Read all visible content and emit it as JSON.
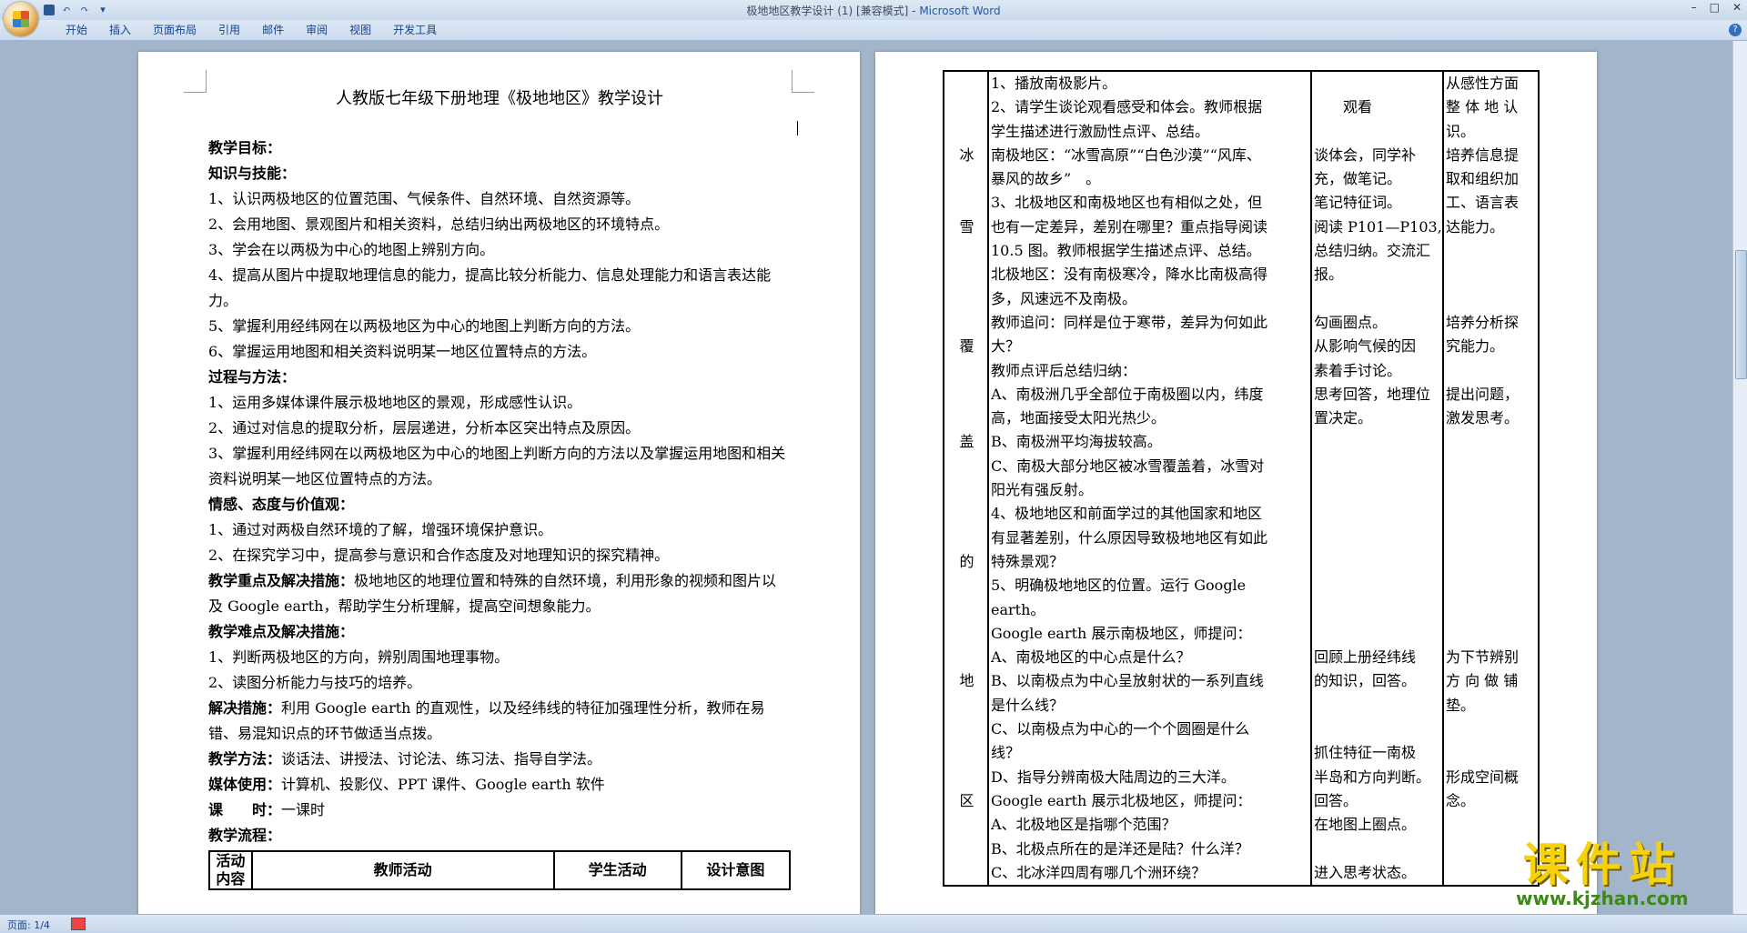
{
  "window": {
    "title": "极地地区教学设计 (1) [兼容模式] - ",
    "app_name": "Microsoft Word",
    "controls": [
      "–",
      "□",
      "✕"
    ]
  },
  "quick_access": {
    "icons": [
      "save-icon",
      "undo-icon",
      "redo-icon"
    ],
    "undo": "↶",
    "redo": "↷",
    "more": "▾"
  },
  "ribbon": {
    "tabs": [
      "开始",
      "插入",
      "页面布局",
      "引用",
      "邮件",
      "审阅",
      "视图",
      "开发工具"
    ],
    "help": "?"
  },
  "page1": {
    "title": "人教版七年级下册地理《极地地区》教学设计",
    "lines": [
      {
        "bold": "教学目标：",
        "text": ""
      },
      {
        "bold": "知识与技能：",
        "text": ""
      },
      {
        "bold": "",
        "text": "1、认识两极地区的位置范围、气候条件、自然环境、自然资源等。"
      },
      {
        "bold": "",
        "text": "2、会用地图、景观图片和相关资料，总结归纳出两极地区的环境特点。"
      },
      {
        "bold": "",
        "text": "3、学会在以两极为中心的地图上辨别方向。"
      },
      {
        "bold": "",
        "text": "4、提高从图片中提取地理信息的能力，提高比较分析能力、信息处理能力和语言表达能力。"
      },
      {
        "bold": "",
        "text": "5、掌握利用经纬网在以两极地区为中心的地图上判断方向的方法。"
      },
      {
        "bold": "",
        "text": "6、掌握运用地图和相关资料说明某一地区位置特点的方法。"
      },
      {
        "bold": "过程与方法：",
        "text": ""
      },
      {
        "bold": "",
        "text": "1、运用多媒体课件展示极地地区的景观，形成感性认识。"
      },
      {
        "bold": "",
        "text": "2、通过对信息的提取分析，层层递进，分析本区突出特点及原因。"
      },
      {
        "bold": "",
        "text": "3、掌握利用经纬网在以两极地区为中心的地图上判断方向的方法以及掌握运用地图和相关资料说明某一地区位置特点的方法。"
      },
      {
        "bold": "情感、态度与价值观：",
        "text": ""
      },
      {
        "bold": "",
        "text": "1、通过对两极自然环境的了解，增强环境保护意识。"
      },
      {
        "bold": "",
        "text": "2、在探究学习中，提高参与意识和合作态度及对地理知识的探究精神。"
      },
      {
        "bold": "教学重点及解决措施：",
        "text": "极地地区的地理位置和特殊的自然环境，利用形象的视频和图片以及 Google earth，帮助学生分析理解，提高空间想象能力。"
      },
      {
        "bold": "教学难点及解决措施：",
        "text": ""
      },
      {
        "bold": "",
        "text": "1、判断两极地区的方向，辨别周围地理事物。"
      },
      {
        "bold": "",
        "text": "2、读图分析能力与技巧的培养。"
      },
      {
        "bold": "解决措施：",
        "text": "利用 Google earth 的直观性，以及经纬线的特征加强理性分析，教师在易错、易混知识点的环节做适当点拨。"
      },
      {
        "bold": "教学方法：",
        "text": "谈话法、讲授法、讨论法、练习法、指导自学法。"
      },
      {
        "bold": "媒体使用：",
        "text": "计算机、投影仪、PPT 课件、Google earth 软件"
      },
      {
        "bold": "课　　时：",
        "text": "一课时"
      },
      {
        "bold": "教学流程：",
        "text": ""
      }
    ],
    "flow_header": [
      "活动内容",
      "教师活动",
      "学生活动",
      "设计意图"
    ]
  },
  "page2": {
    "left_col": [
      "",
      "",
      "",
      "冰",
      "",
      "",
      "雪",
      "",
      "",
      "",
      "",
      "覆",
      "",
      "",
      "",
      "盖",
      "",
      "",
      "",
      "",
      "的",
      "",
      "",
      "",
      "",
      "地",
      "",
      "",
      "",
      "",
      "区"
    ],
    "teacher": [
      "1、播放南极影片。",
      "2、请学生谈论观看感受和体会。教师根据",
      "学生描述进行激励性点评、总结。",
      "南极地区：“冰雪高原”“白色沙漠”“风库、",
      "暴风的故乡”　。",
      "3、北极地区和南极地区也有相似之处，但",
      "也有一定差异，差别在哪里？重点指导阅读",
      "10.5 图。教师根据学生描述点评、总结。",
      "北极地区：没有南极寒冷，降水比南极高得",
      "多，风速远不及南极。",
      "教师追问：同样是位于寒带，差异为何如此",
      "大？",
      "教师点评后总结归纳：",
      "A、南极洲几乎全部位于南极圈以内，纬度",
      "高，地面接受太阳光热少。",
      "B、南极洲平均海拔较高。",
      "C、南极大部分地区被冰雪覆盖着，冰雪对",
      "阳光有强反射。",
      "4、极地地区和前面学过的其他国家和地区",
      "有显著差别，什么原因导致极地地区有如此",
      "特殊景观？",
      "5、明确极地地区的位置。运行 Google",
      "earth。",
      "Google earth 展示南极地区，师提问：",
      "A、南极地区的中心点是什么？",
      "B、以南极点为中心呈放射状的一系列直线",
      "是什么线？",
      "C、以南极点为中心的一个个圆圈是什么",
      "线？",
      "D、指导分辨南极大陆周边的三大洋。",
      "Google earth 展示北极地区，师提问：",
      "A、北极地区是指哪个范围？",
      "B、北极点所在的是洋还是陆？什么洋？",
      "C、北冰洋四周有哪几个洲环绕？"
    ],
    "student": [
      "",
      "　　观看",
      "",
      "谈体会，同学补",
      "充，做笔记。",
      "笔记特征词。",
      "阅读 P101—P103,",
      "总结归纳。交流汇",
      "报。",
      "",
      "勾画圈点。",
      "从影响气候的因",
      "素着手讨论。",
      "思考回答，地理位",
      "置决定。",
      "",
      "",
      "",
      "",
      "",
      "",
      "",
      "",
      "",
      "回顾上册经纬线",
      "的知识，回答。",
      "",
      "",
      "抓住特征一南极",
      "半岛和方向判断。",
      "回答。",
      "在地图上圈点。",
      "",
      "进入思考状态。"
    ],
    "design": [
      "从感性方面",
      "整 体 地 认",
      "识。",
      "培养信息提",
      "取和组织加",
      "工、语言表",
      "达能力。",
      "",
      "",
      "",
      "培养分析探",
      "究能力。",
      "",
      "提出问题，",
      "激发思考。",
      "",
      "",
      "",
      "",
      "",
      "",
      "",
      "",
      "",
      "为下节辨别",
      "方 向 做 铺",
      "垫。",
      "",
      "",
      "形成空间概",
      "念。",
      "",
      "",
      ""
    ]
  },
  "statusbar": {
    "page": "页面: 1/4"
  },
  "watermark": {
    "big": "课件站",
    "small": "www.kjzhan.com"
  }
}
